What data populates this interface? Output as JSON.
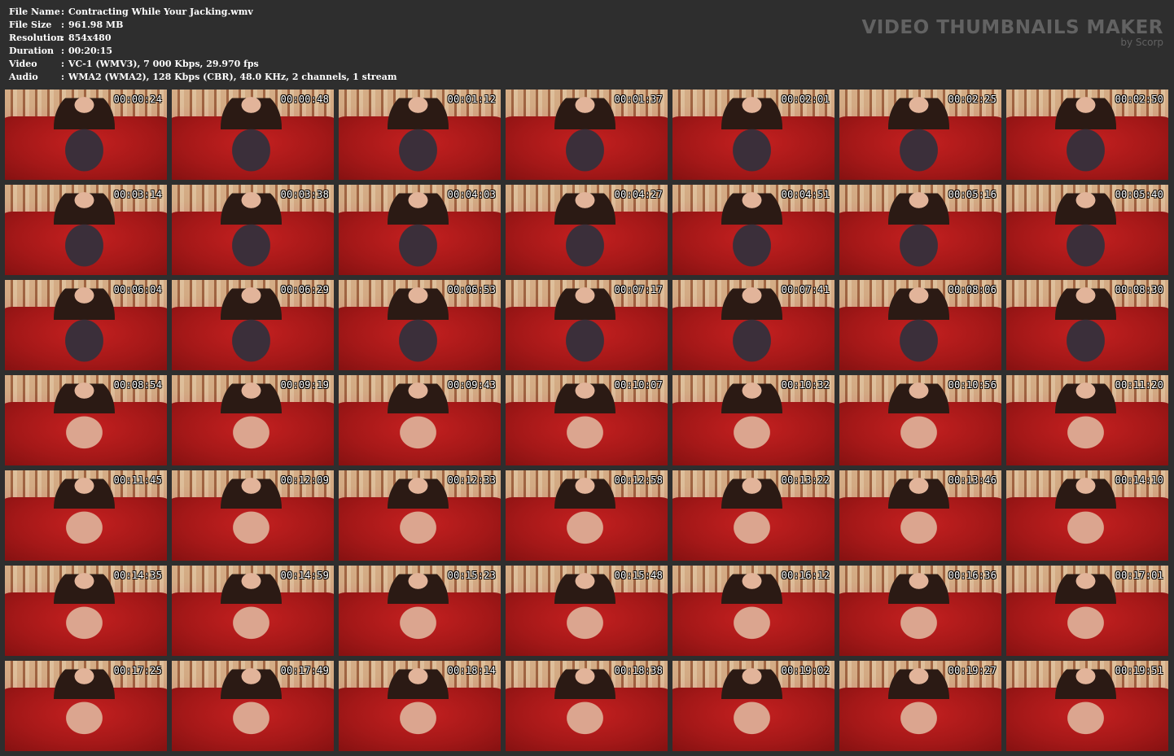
{
  "header": {
    "rows": [
      {
        "label": "File Name",
        "sep": ":",
        "value": "Contracting While Your Jacking.wmv"
      },
      {
        "label": "File Size",
        "sep": ":",
        "value": "961.98 MB"
      },
      {
        "label": "Resolution",
        "sep": ":",
        "value": "854x480"
      },
      {
        "label": "Duration",
        "sep": ":",
        "value": "00:20:15"
      },
      {
        "label": "Video",
        "sep": ":",
        "value": "VC-1 (WMV3), 7 000 Kbps, 29.970 fps"
      },
      {
        "label": "Audio",
        "sep": ":",
        "value": "WMA2 (WMA2), 128 Kbps (CBR), 48.0 KHz, 2 channels, 1 stream"
      }
    ]
  },
  "brand": {
    "title": "VIDEO THUMBNAILS MAKER",
    "subtitle": "by Scorp"
  },
  "thumbnails": [
    {
      "time": "00:00:24",
      "style": "dress"
    },
    {
      "time": "00:00:48",
      "style": "dress"
    },
    {
      "time": "00:01:12",
      "style": "dress"
    },
    {
      "time": "00:01:37",
      "style": "dress"
    },
    {
      "time": "00:02:01",
      "style": "dress"
    },
    {
      "time": "00:02:25",
      "style": "dress"
    },
    {
      "time": "00:02:50",
      "style": "dress"
    },
    {
      "time": "00:03:14",
      "style": "dress"
    },
    {
      "time": "00:03:38",
      "style": "dress"
    },
    {
      "time": "00:04:03",
      "style": "dress"
    },
    {
      "time": "00:04:27",
      "style": "dress"
    },
    {
      "time": "00:04:51",
      "style": "dress"
    },
    {
      "time": "00:05:16",
      "style": "dress"
    },
    {
      "time": "00:05:40",
      "style": "dress"
    },
    {
      "time": "00:06:04",
      "style": "dress"
    },
    {
      "time": "00:06:29",
      "style": "dress"
    },
    {
      "time": "00:06:53",
      "style": "dress"
    },
    {
      "time": "00:07:17",
      "style": "dress"
    },
    {
      "time": "00:07:41",
      "style": "dress"
    },
    {
      "time": "00:08:06",
      "style": "dress"
    },
    {
      "time": "00:08:30",
      "style": "dress"
    },
    {
      "time": "00:08:54",
      "style": "plain"
    },
    {
      "time": "00:09:19",
      "style": "plain"
    },
    {
      "time": "00:09:43",
      "style": "plain"
    },
    {
      "time": "00:10:07",
      "style": "plain"
    },
    {
      "time": "00:10:32",
      "style": "plain"
    },
    {
      "time": "00:10:56",
      "style": "plain"
    },
    {
      "time": "00:11:20",
      "style": "plain"
    },
    {
      "time": "00:11:45",
      "style": "plain"
    },
    {
      "time": "00:12:09",
      "style": "plain"
    },
    {
      "time": "00:12:33",
      "style": "plain"
    },
    {
      "time": "00:12:58",
      "style": "plain"
    },
    {
      "time": "00:13:22",
      "style": "plain"
    },
    {
      "time": "00:13:46",
      "style": "plain"
    },
    {
      "time": "00:14:10",
      "style": "plain"
    },
    {
      "time": "00:14:35",
      "style": "plain"
    },
    {
      "time": "00:14:59",
      "style": "plain"
    },
    {
      "time": "00:15:23",
      "style": "plain"
    },
    {
      "time": "00:15:48",
      "style": "plain"
    },
    {
      "time": "00:16:12",
      "style": "plain"
    },
    {
      "time": "00:16:36",
      "style": "plain"
    },
    {
      "time": "00:17:01",
      "style": "plain"
    },
    {
      "time": "00:17:25",
      "style": "plain"
    },
    {
      "time": "00:17:49",
      "style": "plain"
    },
    {
      "time": "00:18:14",
      "style": "plain"
    },
    {
      "time": "00:18:38",
      "style": "plain"
    },
    {
      "time": "00:19:02",
      "style": "plain"
    },
    {
      "time": "00:19:27",
      "style": "plain"
    },
    {
      "time": "00:19:51",
      "style": "plain"
    }
  ]
}
